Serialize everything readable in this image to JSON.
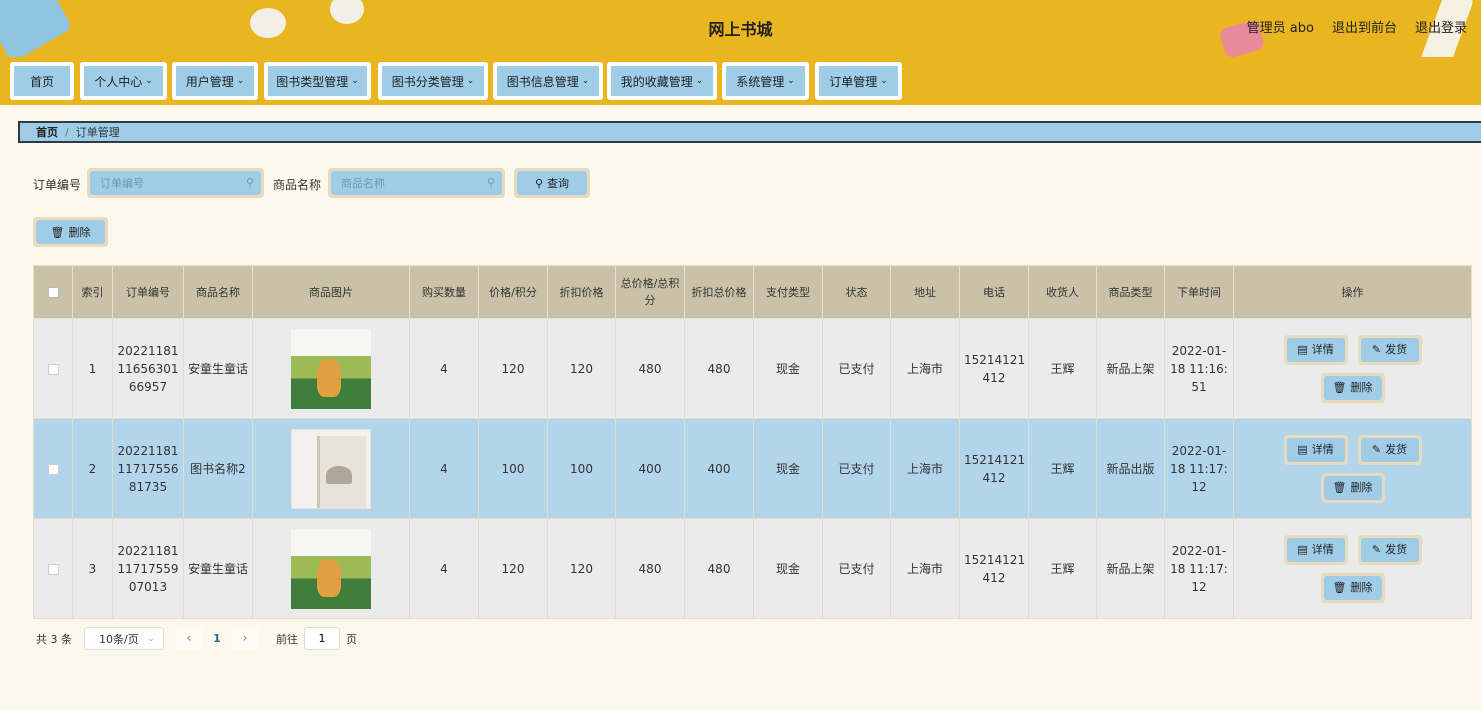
{
  "header": {
    "title": "网上书城",
    "user_label": "管理员 abo",
    "front_link": "退出到前台",
    "logout_link": "退出登录",
    "bg_color": "#e9b520"
  },
  "nav": {
    "items": [
      {
        "label": "首页",
        "has_dropdown": false
      },
      {
        "label": "个人中心",
        "has_dropdown": true
      },
      {
        "label": "用户管理",
        "has_dropdown": true
      },
      {
        "label": "图书类型管理",
        "has_dropdown": true
      },
      {
        "label": "图书分类管理",
        "has_dropdown": true
      },
      {
        "label": "图书信息管理",
        "has_dropdown": true
      },
      {
        "label": "我的收藏管理",
        "has_dropdown": true
      },
      {
        "label": "系统管理",
        "has_dropdown": true
      },
      {
        "label": "订单管理",
        "has_dropdown": true
      }
    ]
  },
  "breadcrumb": {
    "home": "首页",
    "separator": "/",
    "current": "订单管理"
  },
  "search": {
    "order_no_label": "订单编号",
    "order_no_placeholder": "订单编号",
    "product_label": "商品名称",
    "product_placeholder": "商品名称",
    "query_button": "查询"
  },
  "toolbar": {
    "delete_button": "删除"
  },
  "table": {
    "columns": [
      "索引",
      "订单编号",
      "商品名称",
      "商品图片",
      "购买数量",
      "价格/积分",
      "折扣价格",
      "总价格/总积分",
      "折扣总价格",
      "支付类型",
      "状态",
      "地址",
      "电话",
      "收货人",
      "商品类型",
      "下单时间",
      "操作"
    ],
    "rows": [
      {
        "index": "1",
        "order_no": "20221181 11656301 66957",
        "product": "安童生童话",
        "qty": "4",
        "price": "120",
        "discount_price": "120",
        "total": "480",
        "discount_total": "480",
        "pay_type": "现金",
        "status": "已支付",
        "address": "上海市",
        "phone": "15214121 412",
        "receiver": "王辉",
        "product_type": "新品上架",
        "order_time": "2022-01- 18 11:16: 51",
        "cover": "book-cover-rabbit"
      },
      {
        "index": "2",
        "order_no": "20221181 11717556 81735",
        "product": "图书名称2",
        "qty": "4",
        "price": "100",
        "discount_price": "100",
        "total": "400",
        "discount_total": "400",
        "pay_type": "现金",
        "status": "已支付",
        "address": "上海市",
        "phone": "15214121 412",
        "receiver": "王辉",
        "product_type": "新品出版",
        "order_time": "2022-01- 18 11:17: 12",
        "cover": "book-cover-ink"
      },
      {
        "index": "3",
        "order_no": "20221181 11717559 07013",
        "product": "安童生童话",
        "qty": "4",
        "price": "120",
        "discount_price": "120",
        "total": "480",
        "discount_total": "480",
        "pay_type": "现金",
        "status": "已支付",
        "address": "上海市",
        "phone": "15214121 412",
        "receiver": "王辉",
        "product_type": "新品上架",
        "order_time": "2022-01- 18 11:17: 12",
        "cover": "book-cover-rabbit"
      }
    ],
    "actions": {
      "detail": "详情",
      "ship": "发货",
      "delete": "删除"
    }
  },
  "pagination": {
    "total_text": "共 3 条",
    "page_size": "10条/页",
    "current_page": "1",
    "goto_prefix": "前往",
    "goto_value": "1",
    "goto_suffix": "页"
  }
}
